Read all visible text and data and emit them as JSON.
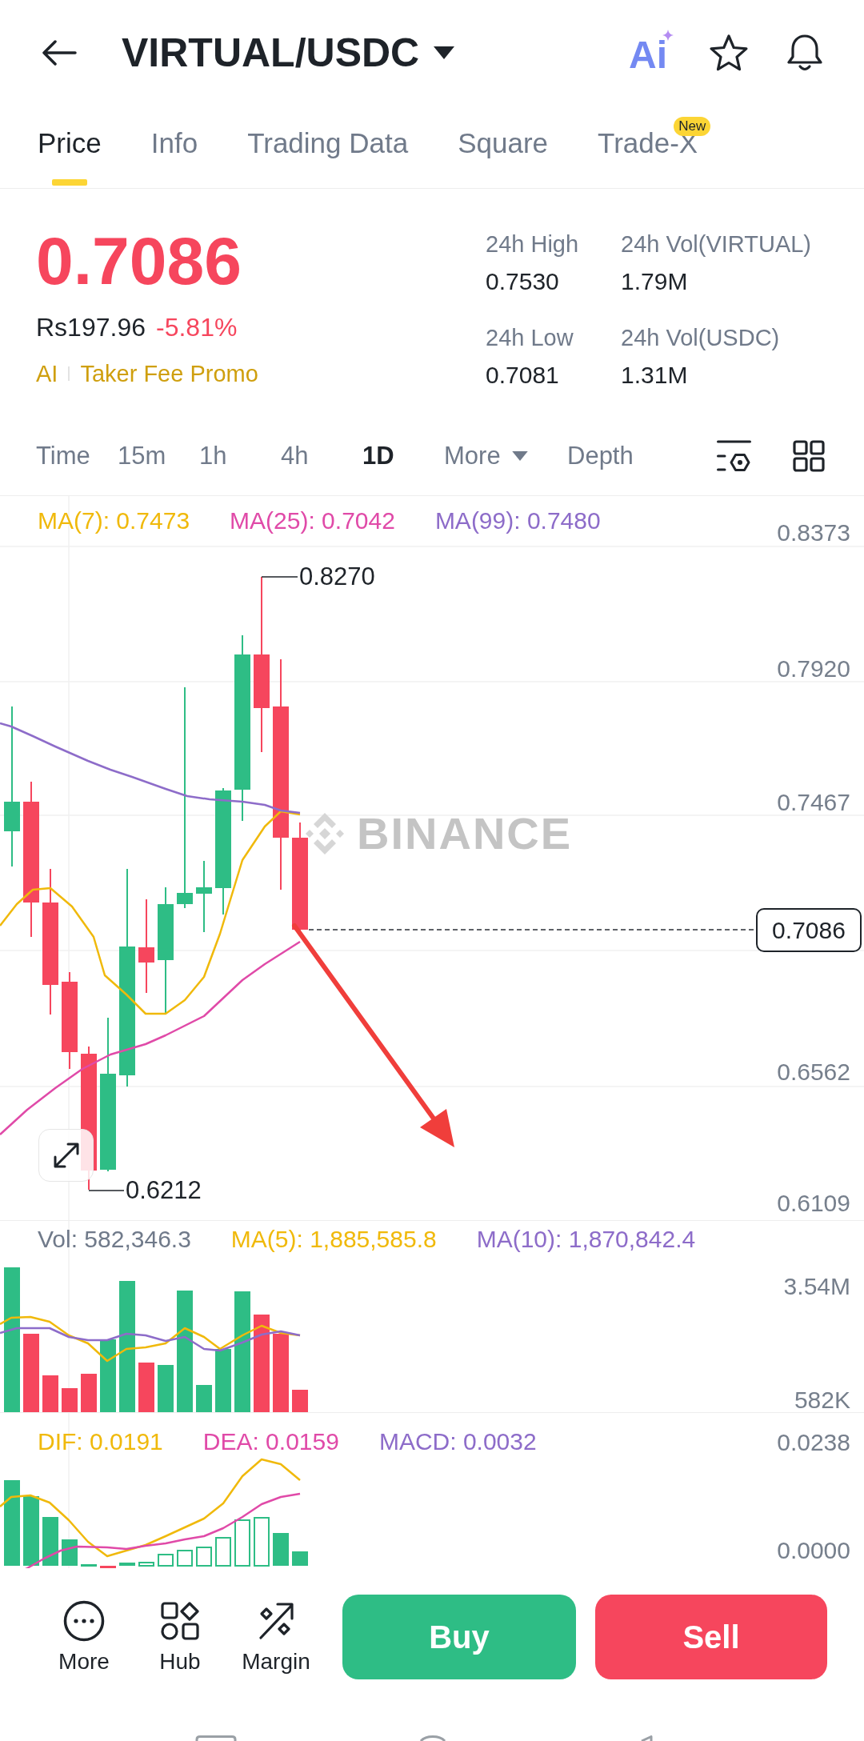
{
  "header": {
    "title": "VIRTUAL/USDC",
    "ai_label": "Ai"
  },
  "tabs": [
    {
      "label": "Price",
      "selected": true
    },
    {
      "label": "Info",
      "selected": false
    },
    {
      "label": "Trading Data",
      "selected": false
    },
    {
      "label": "Square",
      "selected": false
    },
    {
      "label": "Trade-X",
      "selected": false,
      "badge": "New"
    }
  ],
  "ticker": {
    "last_price": "0.7086",
    "fiat_price": "Rs197.96",
    "change": "-5.81%",
    "tags": [
      "AI",
      "Taker Fee Promo"
    ],
    "stats": [
      {
        "label": "24h High",
        "value": "0.7530"
      },
      {
        "label": "24h Vol(VIRTUAL)",
        "value": "1.79M"
      },
      {
        "label": "24h Low",
        "value": "0.7081"
      },
      {
        "label": "24h Vol(USDC)",
        "value": "1.31M"
      }
    ]
  },
  "intervals": [
    {
      "label": "Time",
      "kind": "option",
      "selected": false
    },
    {
      "label": "15m",
      "kind": "option",
      "selected": false
    },
    {
      "label": "1h",
      "kind": "option",
      "selected": false
    },
    {
      "label": "4h",
      "kind": "option",
      "selected": false
    },
    {
      "label": "1D",
      "kind": "option",
      "selected": true
    },
    {
      "label": "More",
      "kind": "dropdown",
      "selected": false
    },
    {
      "label": "Depth",
      "kind": "option",
      "selected": false
    }
  ],
  "price_chart": {
    "legend": [
      {
        "label": "MA(7): 0.7473",
        "color": "#f0b90b"
      },
      {
        "label": "MA(25): 0.7042",
        "color": "#e04aa8"
      },
      {
        "label": "MA(99): 0.7480",
        "color": "#8d6cc9"
      }
    ],
    "axis_labels": [
      "0.8373",
      "0.7920",
      "0.7467",
      "0.6562",
      "0.6109"
    ],
    "high_label": "0.8270",
    "low_label": "0.6212",
    "last_price_tag": "0.7086",
    "watermark": "BINANCE"
  },
  "volume_chart": {
    "legend": [
      {
        "label": "Vol: 582,346.3",
        "color": "#707a8a"
      },
      {
        "label": "MA(5): 1,885,585.8",
        "color": "#f0b90b"
      },
      {
        "label": "MA(10): 1,870,842.4",
        "color": "#8d6cc9"
      }
    ],
    "axis_labels": [
      "3.54M",
      "582K"
    ]
  },
  "macd_chart": {
    "legend": [
      {
        "label": "DIF: 0.0191",
        "color": "#f0b90b"
      },
      {
        "label": "DEA: 0.0159",
        "color": "#e04aa8"
      },
      {
        "label": "MACD: 0.0032",
        "color": "#8d6cc9"
      }
    ],
    "axis_labels": [
      "0.0238",
      "0.0000"
    ]
  },
  "actions": {
    "shortcuts": [
      {
        "label": "More"
      },
      {
        "label": "Hub"
      },
      {
        "label": "Margin"
      }
    ],
    "buy": "Buy",
    "sell": "Sell"
  }
}
